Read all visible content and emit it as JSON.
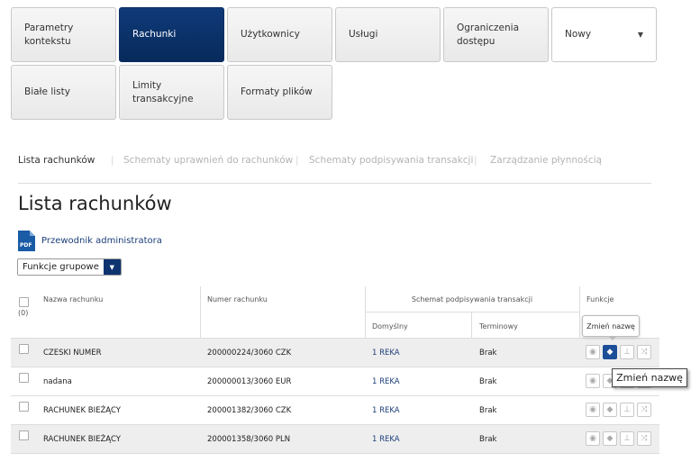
{
  "tiles": {
    "t1": "Parametry kontekstu",
    "t2": "Rachunki",
    "t3": "Użytkownicy",
    "t4": "Usługi",
    "t5": "Ograniczenia dostępu",
    "t6": "Nowy",
    "t7": "Białe listy",
    "t8": "Limity transakcyjne",
    "t9": "Formaty plików"
  },
  "subnav": {
    "s1": "Lista rachunków",
    "s2": "Schematy uprawnień do rachunków",
    "s3": "Schematy podpisywania transakcji",
    "s4": "Zarządzanie płynnością",
    "sep": "|"
  },
  "page": {
    "title": "Lista rachunków",
    "pdf_label": "Przewodnik administratora",
    "pdf_icon_text": "PDF",
    "bulk_label": "Funkcje grupowe"
  },
  "table": {
    "count": "(0)",
    "col_name": "Nazwa rachunku",
    "col_number": "Numer rachunku",
    "col_scheme": "Schemat podpisywania transakcji",
    "col_default": "Domyślny",
    "col_term": "Terminowy",
    "col_functions": "Funkcje",
    "rows": [
      {
        "name": "CZESKI NUMER",
        "number": "200000224/3060 CZK",
        "default": "1 REKA",
        "term": "Brak"
      },
      {
        "name": "nadana",
        "number": "200000013/3060 EUR",
        "default": "1 REKA",
        "term": "Brak"
      },
      {
        "name": "RACHUNEK BIEŻĄCY",
        "number": "200001382/3060 CZK",
        "default": "1 REKA",
        "term": "Brak"
      },
      {
        "name": "RACHUNEK BIEŻĄCY",
        "number": "200001358/3060 PLN",
        "default": "1 REKA",
        "term": "Brak"
      }
    ]
  },
  "tooltips": {
    "rename_small": "Zmień nazwę",
    "rename_native": "Zmień nazwę"
  },
  "icons": {
    "view": "eye-icon",
    "rename": "tag-icon",
    "hierarchy": "hierarchy-icon",
    "shuffle": "shuffle-icon"
  },
  "colors": {
    "accent": "#0d3470",
    "link": "#1d3f7a"
  }
}
